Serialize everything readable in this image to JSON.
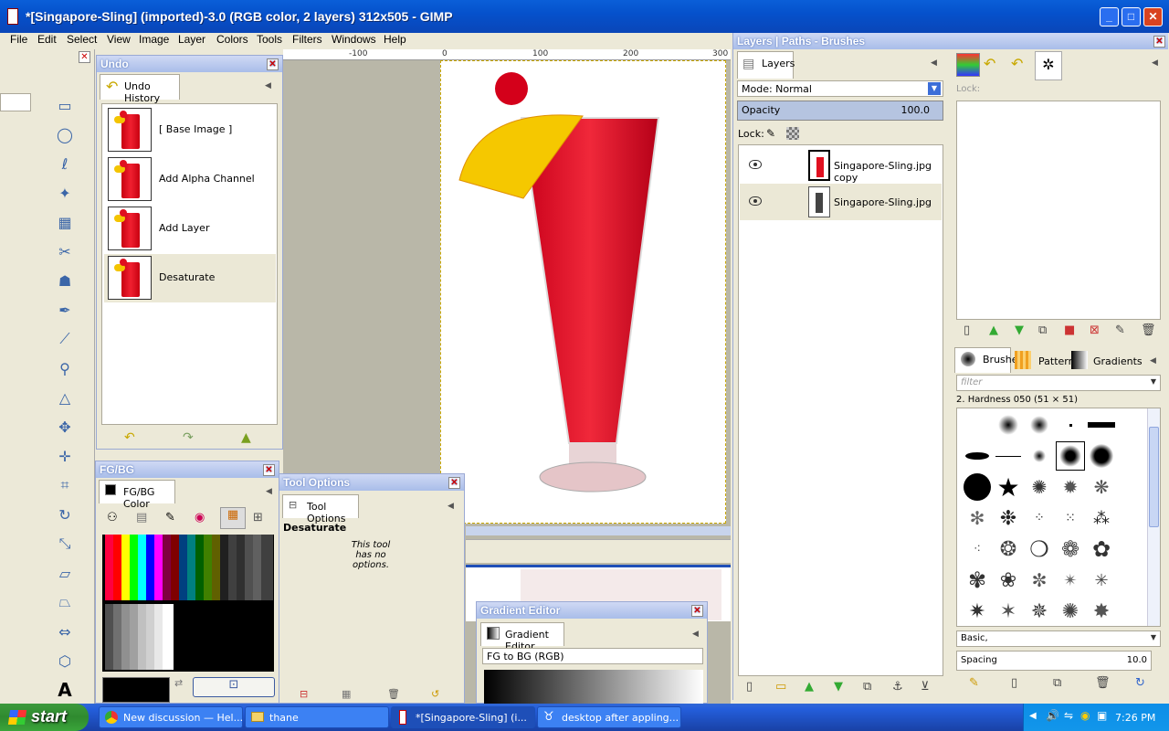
{
  "window": {
    "title": "*[Singapore-Sling] (imported)-3.0 (RGB color, 2 layers) 312x505 - GIMP"
  },
  "menu": [
    "File",
    "Edit",
    "Select",
    "View",
    "Image",
    "Layer",
    "Colors",
    "Tools",
    "Filters",
    "Windows",
    "Help"
  ],
  "ruler": {
    "labels": [
      "-100",
      "0",
      "100",
      "200",
      "300"
    ]
  },
  "undo": {
    "title": "Undo",
    "tab": "Undo History",
    "items": [
      "[ Base Image ]",
      "Add Alpha Channel",
      "Add Layer",
      "Desaturate"
    ]
  },
  "fgbg": {
    "title": "FG/BG",
    "tab": "FG/BG Color"
  },
  "tool_options": {
    "title": "Tool Options",
    "tab": "Tool Options",
    "tool": "Desaturate",
    "note": "This tool has no options."
  },
  "gradient_editor": {
    "title": "Gradient Editor",
    "tab": "Gradient Editor",
    "name": "FG to BG (RGB)"
  },
  "layers_dock": {
    "title": "Layers | Paths - Brushes",
    "tab": "Layers",
    "mode_label": "Mode: Normal",
    "opacity_label": "Opacity",
    "opacity_value": "100.0",
    "lock_label": "Lock:",
    "layers": [
      "Singapore-Sling.jpg copy",
      "Singapore-Sling.jpg"
    ]
  },
  "channels": {
    "lock_label": "Lock:"
  },
  "brushes": {
    "tabs": [
      "Brushes",
      "Patterns",
      "Gradients"
    ],
    "filter_placeholder": "filter",
    "selected": "2. Hardness 050 (51 × 51)",
    "tag": "Basic,",
    "spacing_label": "Spacing",
    "spacing_value": "10.0"
  },
  "taskbar": {
    "start": "start",
    "items": [
      "New discussion — Hel...",
      "thane",
      "*[Singapore-Sling] (i...",
      "desktop after appling..."
    ],
    "clock": "7:26 PM"
  }
}
